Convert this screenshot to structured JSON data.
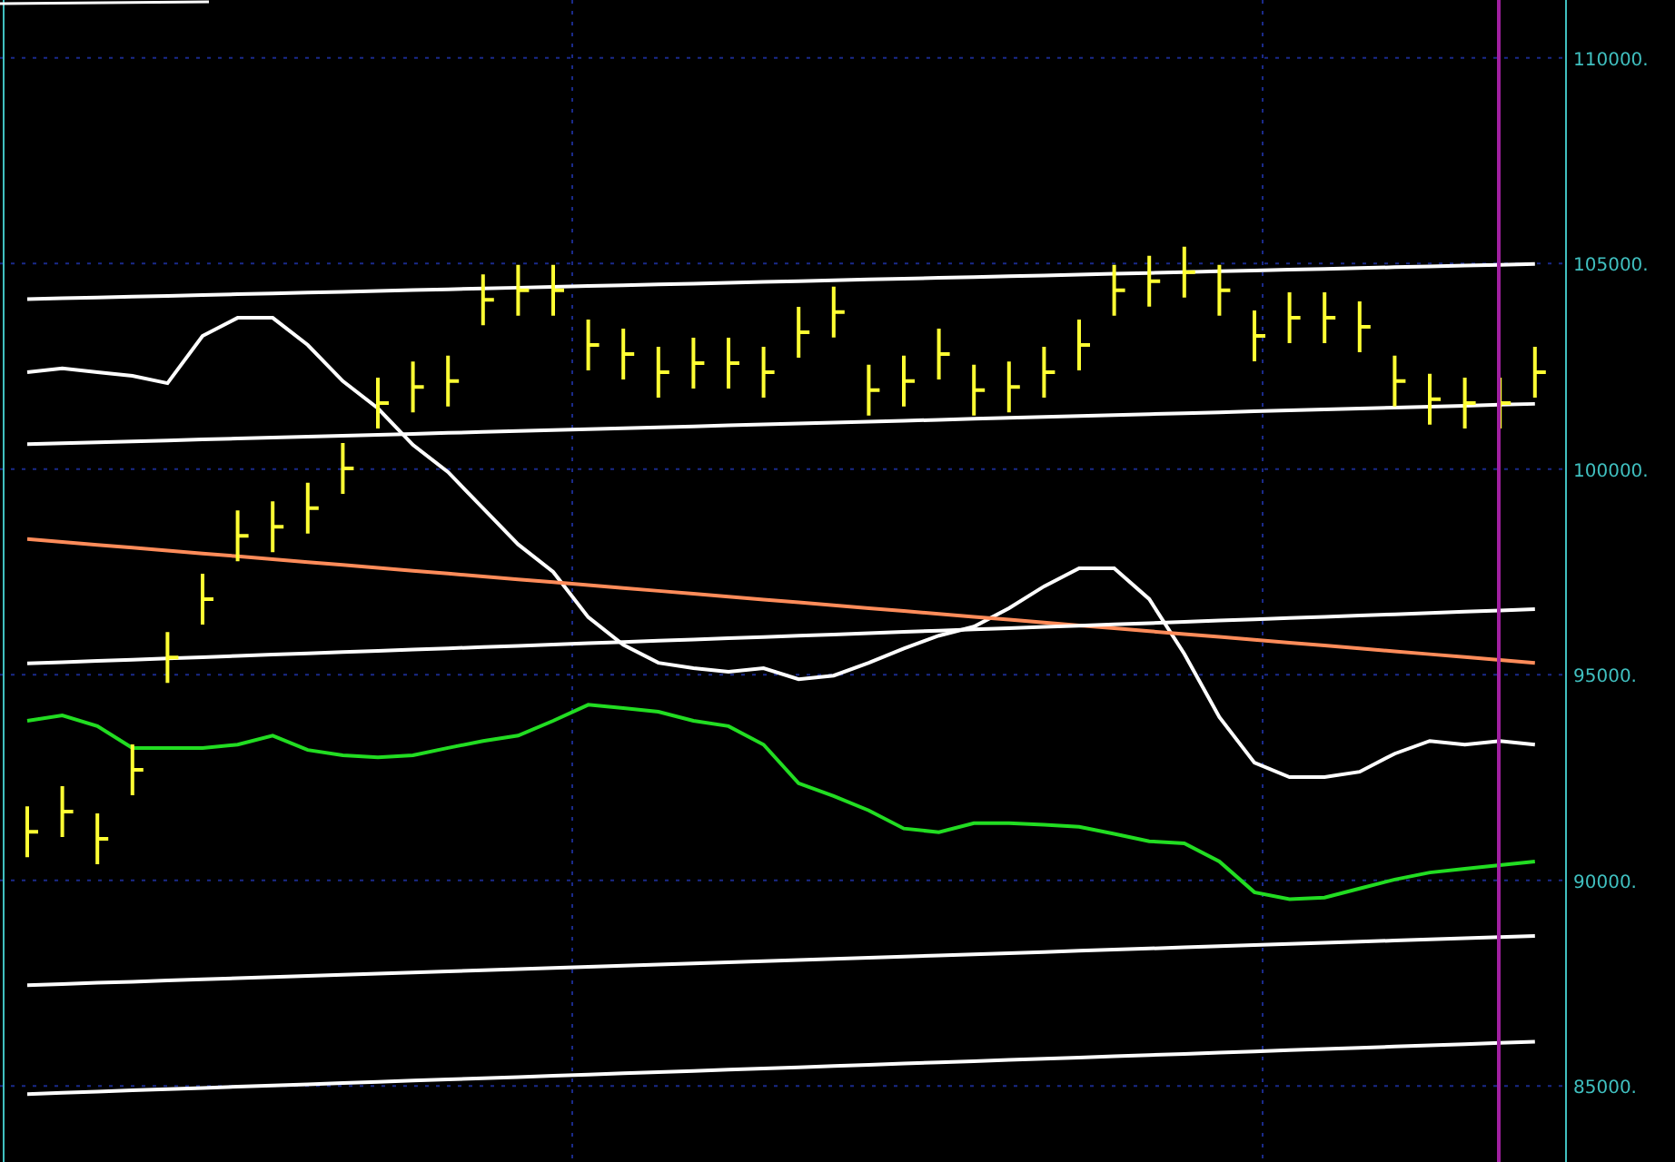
{
  "chart": {
    "chart_data": {
      "type": "line",
      "grid": true,
      "ylim": [
        83150,
        111410
      ],
      "yticks": [
        {
          "value": 85000,
          "label": "85000."
        },
        {
          "value": 90000,
          "label": "90000."
        },
        {
          "value": 95000,
          "label": "95000."
        },
        {
          "value": 100000,
          "label": "100000."
        },
        {
          "value": 105000,
          "label": "105000."
        },
        {
          "value": 110000,
          "label": "110000."
        }
      ],
      "series": [
        {
          "color": "#ffffff",
          "values": [
            102360,
            102450,
            102360,
            102270,
            102090,
            103240,
            103680,
            103680,
            103020,
            102140,
            101480,
            100590,
            99930,
            99050,
            98170,
            97500,
            96400,
            95730,
            95290,
            95160,
            95070,
            95160,
            94890,
            94980,
            95290,
            95640,
            95950,
            96170,
            96620,
            97150,
            97590,
            97590,
            96840,
            95510,
            93970,
            92860,
            92510,
            92510,
            92640,
            93080,
            93390,
            93300,
            93390,
            93300
          ]
        },
        {
          "color": "#ff8c5a",
          "values": [
            98300,
            98230,
            98160,
            98090,
            98020,
            97950,
            97880,
            97810,
            97740,
            97670,
            97600,
            97530,
            97460,
            97390,
            97320,
            97250,
            97180,
            97110,
            97040,
            96970,
            96900,
            96830,
            96760,
            96690,
            96620,
            96550,
            96480,
            96410,
            96340,
            96270,
            96200,
            96130,
            96060,
            95990,
            95920,
            95850,
            95780,
            95710,
            95640,
            95570,
            95500,
            95430,
            95360,
            95290
          ]
        },
        {
          "color": "#22dd22",
          "values": [
            93880,
            94010,
            93750,
            93220,
            93220,
            93220,
            93300,
            93520,
            93170,
            93040,
            92990,
            93040,
            93220,
            93390,
            93520,
            93880,
            94270,
            94190,
            94100,
            93880,
            93750,
            93300,
            92360,
            92050,
            91700,
            91260,
            91170,
            91390,
            91390,
            91350,
            91300,
            91130,
            90950,
            90900,
            90460,
            89710,
            89540,
            89580,
            89800,
            90020,
            90190,
            90280,
            90370,
            90460
          ]
        },
        {
          "color": "#ffffff",
          "values": [
            104135,
            104155,
            104175,
            104195,
            104215,
            104235,
            104254,
            104274,
            104294,
            104314,
            104334,
            104354,
            104374,
            104394,
            104414,
            104434,
            104453,
            104473,
            104493,
            104513,
            104533,
            104553,
            104573,
            104593,
            104613,
            104633,
            104652,
            104672,
            104692,
            104712,
            104732,
            104752,
            104772,
            104792,
            104812,
            104832,
            104851,
            104871,
            104891,
            104911,
            104931,
            104951,
            104971,
            104991
          ]
        },
        {
          "color": "#ffffff",
          "values": [
            100608,
            100631,
            100654,
            100676,
            100699,
            100722,
            100745,
            100768,
            100790,
            100813,
            100836,
            100859,
            100882,
            100904,
            100927,
            100950,
            100973,
            100996,
            101018,
            101041,
            101064,
            101087,
            101110,
            101132,
            101155,
            101178,
            101201,
            101224,
            101246,
            101269,
            101292,
            101315,
            101338,
            101360,
            101383,
            101406,
            101429,
            101452,
            101474,
            101497,
            101520,
            101543,
            101566,
            101588
          ]
        },
        {
          "color": "#ffffff",
          "values": [
            95274,
            95305,
            95335,
            95366,
            95397,
            95428,
            95458,
            95489,
            95520,
            95550,
            95581,
            95612,
            95642,
            95673,
            95704,
            95735,
            95765,
            95796,
            95827,
            95857,
            95888,
            95919,
            95949,
            95980,
            96011,
            96042,
            96072,
            96103,
            96134,
            96164,
            96195,
            96226,
            96256,
            96287,
            96318,
            96349,
            96379,
            96410,
            96441,
            96471,
            96502,
            96533,
            96563,
            96594
          ]
        },
        {
          "color": "#ffffff",
          "values": [
            87452,
            87480,
            87508,
            87535,
            87563,
            87591,
            87619,
            87647,
            87674,
            87702,
            87730,
            87758,
            87786,
            87813,
            87841,
            87869,
            87897,
            87925,
            87952,
            87980,
            88008,
            88036,
            88064,
            88091,
            88119,
            88147,
            88175,
            88203,
            88230,
            88258,
            88286,
            88314,
            88342,
            88369,
            88397,
            88425,
            88453,
            88481,
            88508,
            88536,
            88564,
            88592,
            88620,
            88647
          ]
        },
        {
          "color": "#ffffff",
          "values": [
            84803,
            84833,
            84862,
            84892,
            84921,
            84951,
            84981,
            85010,
            85040,
            85069,
            85099,
            85129,
            85158,
            85188,
            85217,
            85247,
            85277,
            85306,
            85336,
            85365,
            85395,
            85425,
            85454,
            85484,
            85513,
            85543,
            85573,
            85602,
            85632,
            85661,
            85691,
            85721,
            85750,
            85780,
            85809,
            85839,
            85869,
            85898,
            85928,
            85957,
            85987,
            86017,
            86046,
            86076
          ]
        }
      ]
    }
  }
}
